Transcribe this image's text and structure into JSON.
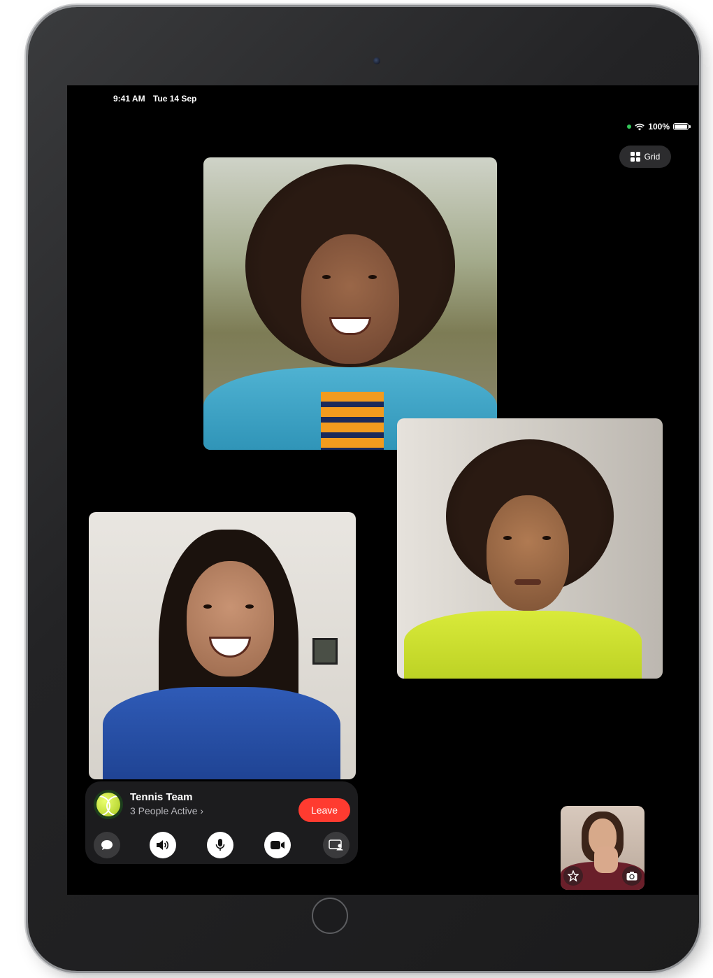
{
  "status_bar": {
    "time": "9:41 AM",
    "date": "Tue 14 Sep",
    "battery": "100%"
  },
  "top_controls": {
    "grid_label": "Grid"
  },
  "participants": [
    {
      "tile": "participant-1",
      "description": "man with curly hair"
    },
    {
      "tile": "participant-2",
      "description": "person with yellow hoodie"
    },
    {
      "tile": "participant-3",
      "description": "woman in blue cardigan"
    }
  ],
  "call": {
    "group_name": "Tennis Team",
    "active_status": "3 People Active",
    "chevron": "›",
    "leave_label": "Leave"
  },
  "icons": {
    "chat": "chat-bubble-icon",
    "speaker": "speaker-icon",
    "mic": "microphone-icon",
    "camera": "video-camera-icon",
    "share": "shareplay-icon",
    "effects": "effects-star-icon",
    "flip": "flip-camera-icon"
  },
  "colors": {
    "leave": "#ff3b30",
    "panel": "#1c1c1e",
    "mic_indicator": "#34c759"
  }
}
